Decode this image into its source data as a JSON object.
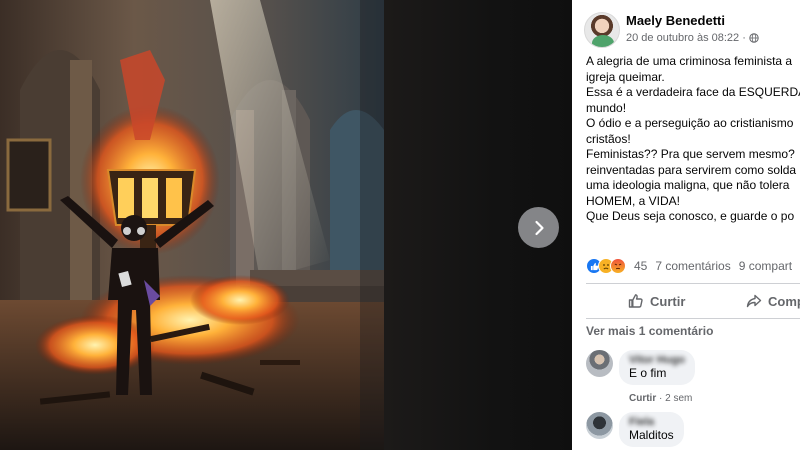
{
  "post": {
    "author": "Maely Benedetti",
    "timestamp": "20 de outubro às 08:22 ·",
    "privacy_icon": "globe-icon",
    "text_lines": [
      "A alegria de uma criminosa feminista a",
      "igreja queimar.",
      "Essa é a verdadeira face da ESQUERDA",
      "mundo!",
      "O ódio e a perseguição ao cristianismo",
      "cristãos!",
      "Feministas?? Pra que servem mesmo?",
      "reinventadas para servirem como solda",
      "uma ideologia maligna, que não tolera",
      "HOMEM, a VIDA!",
      "Que Deus seja conosco, e guarde o po"
    ]
  },
  "stats": {
    "reactions": [
      "like",
      "sad",
      "angry"
    ],
    "reaction_count": "45",
    "comments": "7 comentários",
    "shares": "9 compart"
  },
  "actions": {
    "like_label": "Curtir",
    "share_label": "Comp"
  },
  "comments": {
    "more_label": "Ver mais 1 comentário",
    "items": [
      {
        "name": "Vitor Hugo",
        "text": "E o fim",
        "like_label": "Curtir",
        "age": "· 2 sem"
      },
      {
        "name": "Fiela",
        "text": "Malditos"
      }
    ]
  },
  "viewer": {
    "next_icon": "chevron-right-icon"
  }
}
